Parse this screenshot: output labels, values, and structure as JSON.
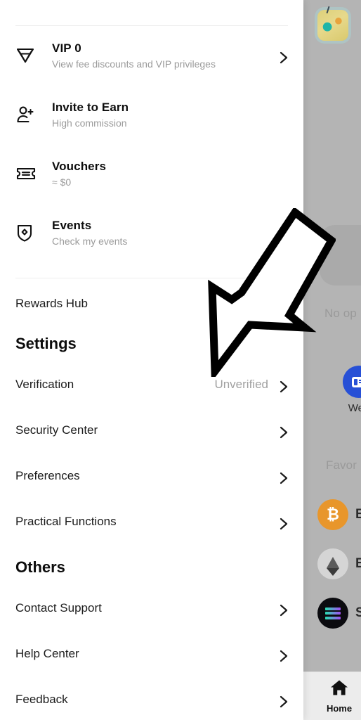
{
  "drawer": {
    "account_rows": [
      {
        "icon": "diamond-icon",
        "title": "VIP 0",
        "sub": "View fee discounts and VIP privileges"
      },
      {
        "icon": "user-plus-icon",
        "title": "Invite to Earn",
        "sub": "High commission"
      },
      {
        "icon": "ticket-icon",
        "title": "Vouchers",
        "sub": "≈ $0"
      },
      {
        "icon": "shield-diamond-icon",
        "title": "Events",
        "sub": "Check my events"
      }
    ],
    "rewards_hub": {
      "label": "Rewards Hub"
    },
    "settings": {
      "heading": "Settings",
      "rows": [
        {
          "label": "Verification",
          "value": "Unverified"
        },
        {
          "label": "Security Center",
          "value": ""
        },
        {
          "label": "Preferences",
          "value": ""
        },
        {
          "label": "Practical Functions",
          "value": ""
        }
      ]
    },
    "others": {
      "heading": "Others",
      "rows": [
        {
          "label": "Contact Support",
          "value": ""
        },
        {
          "label": "Help Center",
          "value": ""
        },
        {
          "label": "Feedback",
          "value": ""
        }
      ]
    }
  },
  "background": {
    "avatar_alt": "profile-avatar",
    "no_open_orders_text": "No op",
    "favorites_text": "Favor",
    "wealth_label": "Wea",
    "coins": [
      {
        "symbol": "BTC",
        "glyph": "₿",
        "label": "B"
      },
      {
        "symbol": "ETH",
        "glyph": "",
        "label": "E"
      },
      {
        "symbol": "SOL",
        "glyph": "",
        "label": "S"
      }
    ],
    "bottom_nav": [
      {
        "icon": "home-icon",
        "label": "Home"
      }
    ]
  },
  "annotation": {
    "type": "arrow",
    "points_to": "Verification",
    "color": "#000000"
  },
  "colors": {
    "drawer_bg": "#ffffff",
    "overlay": "#b4b4b4",
    "text_primary": "#0d0d0d",
    "text_secondary": "#9b9b9b",
    "divider": "#ededed",
    "accent_blue": "#2750d6",
    "btc_orange": "#e8962b"
  }
}
